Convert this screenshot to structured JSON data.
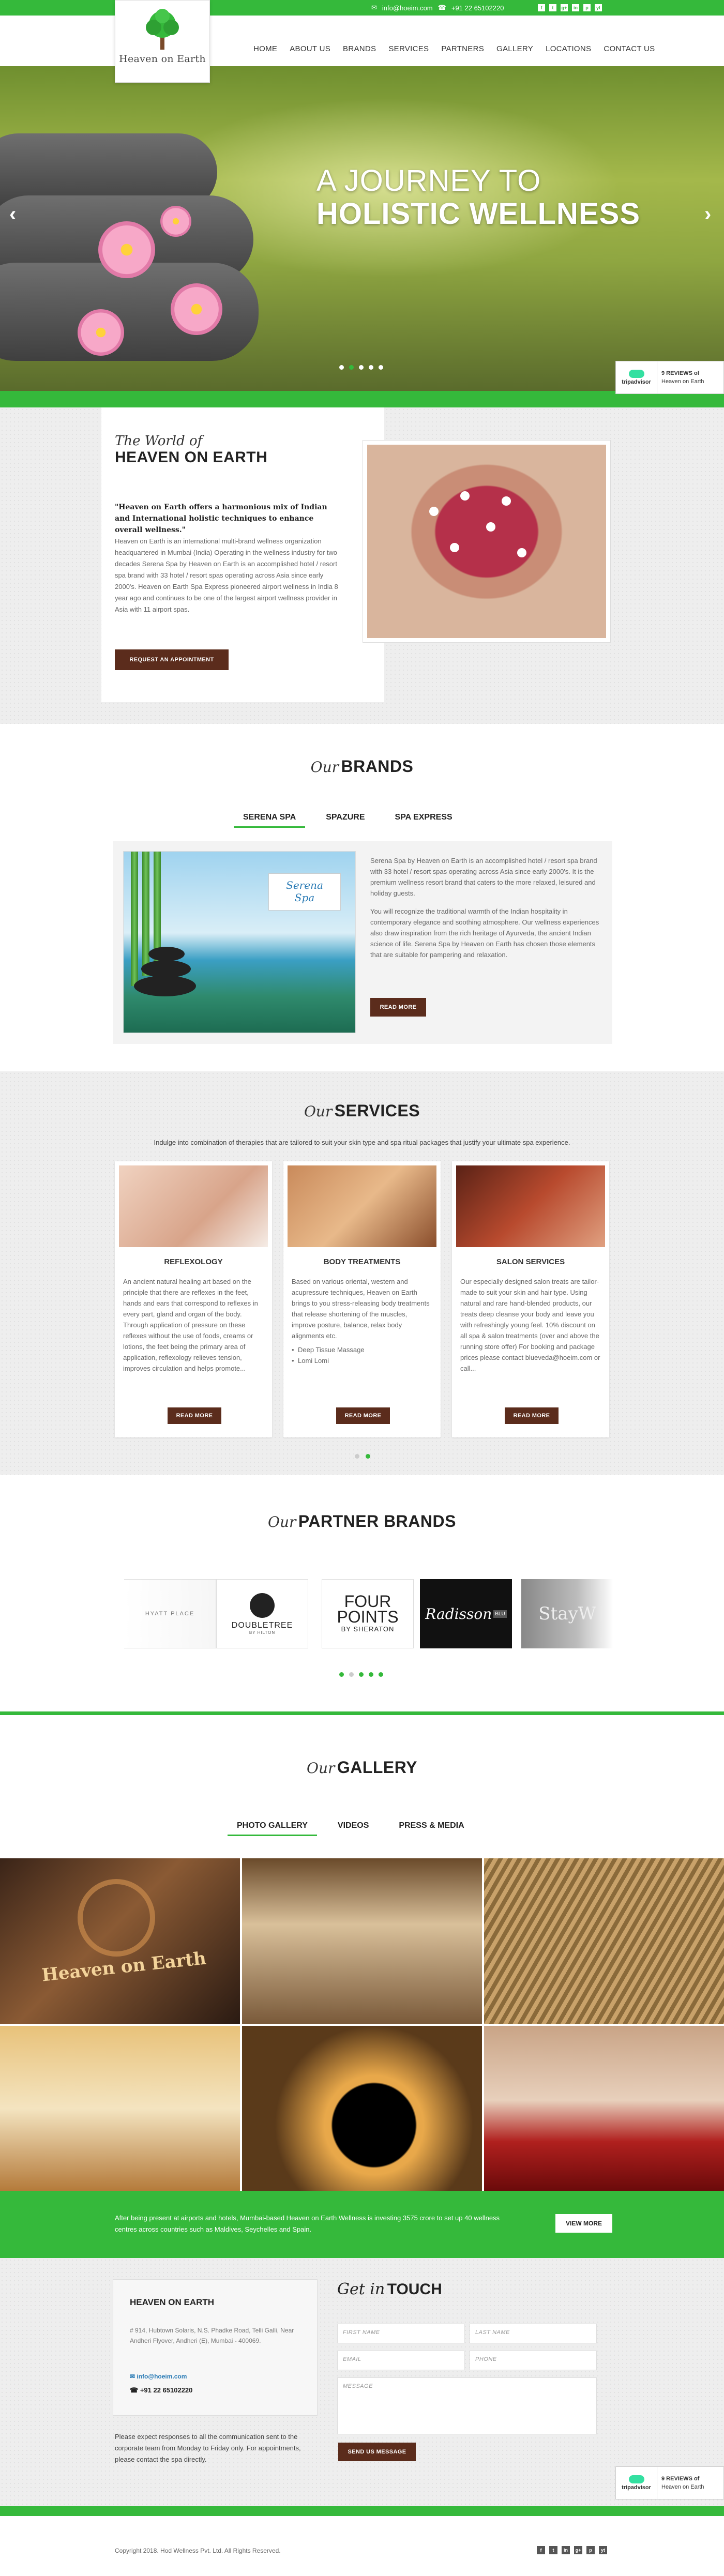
{
  "header": {
    "logo_text": "Heaven on Earth",
    "email": "info@hoeim.com",
    "phone": "+91 22 65102220",
    "social": [
      "f",
      "t",
      "g+",
      "in",
      "p",
      "yt"
    ],
    "nav": [
      "HOME",
      "ABOUT US",
      "BRANDS",
      "SERVICES",
      "PARTNERS",
      "GALLERY",
      "LOCATIONS",
      "CONTACT US"
    ]
  },
  "hero": {
    "line1": "A JOURNEY TO",
    "line2": "HOLISTIC WELLNESS",
    "prev": "‹",
    "next": "›",
    "slides": 5,
    "active_slide": 1
  },
  "tripadvisor": {
    "brand": "tripadvisor",
    "reviews": "9 REVIEWS of",
    "name": "Heaven on Earth"
  },
  "world": {
    "script": "The World of",
    "title": "HEAVEN ON EARTH",
    "intro": "\"Heaven on Earth offers a harmonious mix of Indian and International holistic techniques to enhance overall wellness.\"",
    "body": "Heaven on Earth is an international multi-brand wellness organization headquartered in Mumbai (India) Operating in the wellness industry for two decades Serena Spa by Heaven on Earth is an accomplished hotel / resort spa brand with 33 hotel / resort spas operating across Asia since early 2000's. Heaven on Earth Spa Express pioneered airport wellness in India 8 year ago and continues to be one of the largest airport wellness provider in Asia with 11 airport spas.",
    "button": "REQUEST AN APPOINTMENT"
  },
  "brands": {
    "script": "Our",
    "title": "BRANDS",
    "tabs": [
      "SERENA SPA",
      "SPAZURE",
      "SPA EXPRESS"
    ],
    "active_tab": 0,
    "badge_line1": "Serena",
    "badge_line2": "Spa",
    "para1": "Serena Spa by Heaven on Earth is an accomplished hotel / resort spa brand with 33 hotel / resort spas operating across Asia since early 2000's. It is the premium wellness resort brand that caters to the more relaxed, leisured and holiday guests.",
    "para2": "You will recognize the traditional warmth of the Indian hospitality in contemporary elegance and soothing atmosphere. Our wellness experiences also draw inspiration from the rich heritage of Ayurveda, the ancient Indian science of life. Serena Spa by Heaven on Earth has chosen those elements that are suitable for pampering and relaxation.",
    "button": "READ MORE"
  },
  "services": {
    "script": "Our",
    "title": "SERVICES",
    "description": "Indulge into combination of therapies that are tailored to suit your skin type and spa ritual packages that justify your ultimate spa experience.",
    "cards": [
      {
        "title": "REFLEXOLOGY",
        "text": "An ancient natural healing art based on the principle that there are reflexes in the feet, hands and ears that correspond to reflexes in every part, gland and organ of the body. Through application of pressure on these reflexes without the use of foods, creams or lotions, the feet being the primary area of application, reflexology relieves tension, improves circulation and helps promote...",
        "bullets": [],
        "button": "READ MORE"
      },
      {
        "title": "BODY TREATMENTS",
        "text": "Based on various oriental, western and acupressure techniques, Heaven on Earth brings to you stress-releasing body treatments that release shortening of the muscles, improve posture, balance, relax body alignments etc.",
        "bullets": [
          "Deep Tissue Massage",
          "Lomi Lomi"
        ],
        "button": "READ MORE"
      },
      {
        "title": "SALON SERVICES",
        "text": "Our especially designed salon treats are tailor-made to suit your skin and hair type. Using natural and rare hand-blended products, our treats deep cleanse your body and leave you with refreshingly young feel. 10% discount on all spa & salon treatments (over and above the running store offer) For booking and package prices please contact blueveda@hoeim.com or call...",
        "bullets": [],
        "button": "READ MORE"
      }
    ],
    "pages": 2,
    "active_page": 1
  },
  "partners": {
    "script": "Our",
    "title": "PARTNER BRANDS",
    "logos": [
      "HYATT PLACE",
      "DOUBLETREE",
      "BY HILTON",
      "FOUR",
      "POINTS",
      "BY SHERATON",
      "Radisson",
      "BLU",
      "StayW"
    ],
    "pages": 5,
    "active_page": 0
  },
  "gallery": {
    "script": "Our",
    "title": "GALLERY",
    "tabs": [
      "PHOTO GALLERY",
      "VIDEOS",
      "PRESS & MEDIA"
    ],
    "active_tab": 0,
    "sign": "Heaven on Earth"
  },
  "banner": {
    "text": "After being present at airports and hotels, Mumbai-based Heaven on Earth Wellness is investing 3575 crore to set up 40 wellness centres across countries such as Maldives, Seychelles and Spain.",
    "button": "VIEW MORE"
  },
  "contact": {
    "heading": "HEAVEN ON EARTH",
    "address": "# 914, Hubtown Solaris, N.S. Phadke Road, Telli Galli, Near Andheri Flyover, Andheri (E), Mumbai - 400069.",
    "email": "info@hoeim.com",
    "phone": "+91 22 65102220",
    "note": "Please expect responses to all the communication sent to the corporate team from Monday to Friday only. For appointments, please contact the spa directly.",
    "form_script": "Get in",
    "form_title": "TOUCH",
    "first_name": "FIRST NAME",
    "last_name": "LAST NAME",
    "email_ph": "EMAIL",
    "phone_ph": "PHONE",
    "message_ph": "MESSAGE",
    "submit": "SEND US MESSAGE"
  },
  "footer": {
    "copyright": "Copyright 2018. Hod Wellness Pvt. Ltd. All Rights Reserved.",
    "social": [
      "f",
      "t",
      "in",
      "g+",
      "p",
      "yt"
    ]
  },
  "colors": {
    "accent": "#35b93b",
    "button": "#5b2c1c"
  }
}
